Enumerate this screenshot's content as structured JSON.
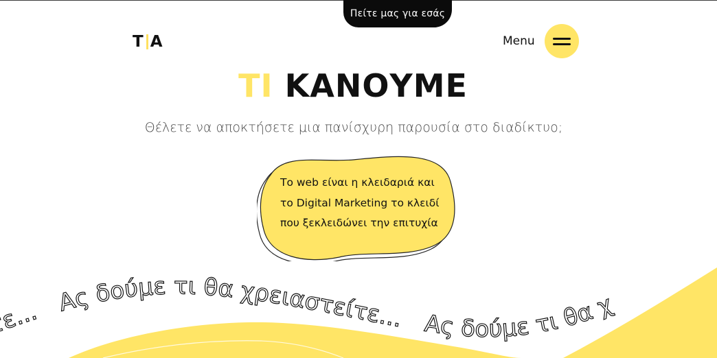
{
  "header": {
    "cta_label": "Πείτε μας για εσάς",
    "logo": {
      "left": "T",
      "right": "A"
    },
    "menu_label": "Menu"
  },
  "hero": {
    "title_highlight": "ΤΙ",
    "title_rest": "ΚΑΝΟΥΜΕ",
    "subtitle": "Θέλετε να αποκτήσετε μια πανίσχυρη παρουσία στο διαδίκτυο;",
    "bubble_lines": [
      "Το web είναι η κλειδαριά και",
      "το Digital Marketing το κλειδί",
      "που ξεκλειδώνει την επιτυχία"
    ]
  },
  "marquee": {
    "left_fragment": "αστείτε...",
    "main_text": "Ας δούμε τι θα χρειαστείτε...",
    "repeat_text": "Ας δούμε τι θα χ"
  },
  "colors": {
    "accent": "#ffe566",
    "dark": "#0b0b0b",
    "text": "#111111"
  }
}
